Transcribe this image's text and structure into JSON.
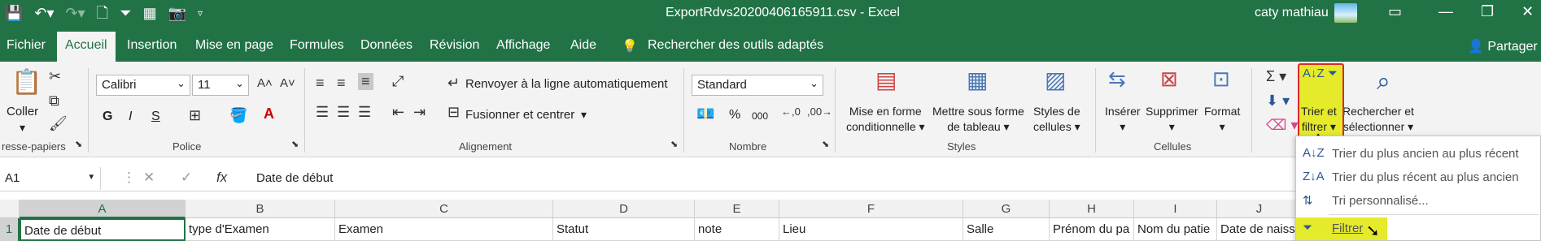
{
  "window": {
    "title": "ExportRdvs20200406165911.csv  -  Excel",
    "user": "caty mathiau"
  },
  "tabs": [
    "Fichier",
    "Accueil",
    "Insertion",
    "Mise en page",
    "Formules",
    "Données",
    "Révision",
    "Affichage",
    "Aide"
  ],
  "active_tab": "Accueil",
  "tell_me": "Rechercher des outils adaptés",
  "share": "Partager",
  "ribbon": {
    "clipboard": {
      "paste": "Coller",
      "label": "resse-papiers"
    },
    "font": {
      "name": "Calibri",
      "size": "11",
      "bold": "G",
      "italic": "I",
      "underline": "S",
      "label": "Police"
    },
    "alignment": {
      "wrap": "Renvoyer à la ligne automatiquement",
      "merge": "Fusionner et centrer",
      "label": "Alignement"
    },
    "number": {
      "format": "Standard",
      "percent": "%",
      "thousands": "000",
      "label": "Nombre"
    },
    "styles": {
      "conditional_1": "Mise en forme",
      "conditional_2": "conditionnelle",
      "table_1": "Mettre sous forme",
      "table_2": "de tableau",
      "cell_1": "Styles de",
      "cell_2": "cellules",
      "label": "Styles"
    },
    "cells": {
      "insert": "Insérer",
      "delete": "Supprimer",
      "format": "Format",
      "label": "Cellules"
    },
    "editing": {
      "sort_1": "Trier et",
      "sort_2": "filtrer",
      "find_1": "Rechercher et",
      "find_2": "sélectionner"
    }
  },
  "formula_bar": {
    "namebox": "A1",
    "fx": "fx",
    "value": "Date de début"
  },
  "columns": [
    "A",
    "B",
    "C",
    "D",
    "E",
    "F",
    "G",
    "H",
    "I",
    "J"
  ],
  "row_number": "1",
  "row1": [
    "Date de début",
    "type d'Examen",
    "Examen",
    "Statut",
    "note",
    "Lieu",
    "Salle",
    "Prénom du pa",
    "Nom du patie",
    "Date de naiss"
  ],
  "sort_menu": [
    {
      "label": "Trier du plus ancien au plus récent",
      "icon": "sort-az-icon"
    },
    {
      "label": "Trier du plus récent au plus ancien",
      "icon": "sort-za-icon"
    },
    {
      "label": "Tri personnalisé...",
      "icon": "custom-sort-icon"
    },
    {
      "label": "Filtrer",
      "icon": "filter-icon"
    }
  ],
  "colors": {
    "excel_green": "#217346",
    "highlight": "#e5ea2a",
    "red_border": "#d72a2a"
  }
}
